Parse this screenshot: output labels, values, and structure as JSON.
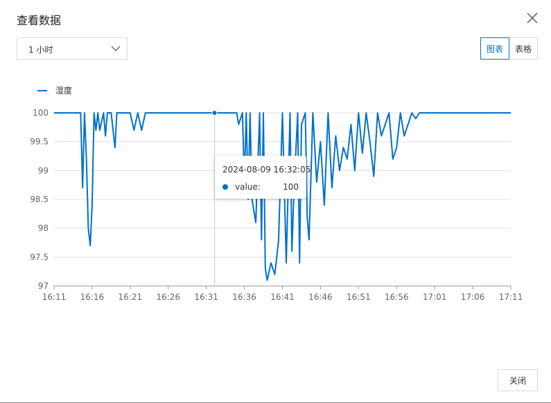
{
  "dialog": {
    "title": "查看数据",
    "close_icon": "close-icon"
  },
  "time_range": {
    "selected": "1 小时",
    "chevron_icon": "chevron-down-icon"
  },
  "view_toggle": {
    "chart_label": "图表",
    "table_label": "表格",
    "active": "chart"
  },
  "tooltip": {
    "time": "2024-08-09 16:32:05",
    "key": "value:",
    "value": "100"
  },
  "footer": {
    "close_label": "关闭"
  },
  "colors": {
    "accent": "#0070cc",
    "grid": "#e0e0e0"
  },
  "chart_data": {
    "type": "line",
    "legend": "湿度",
    "legend_position": "top-left",
    "grid": true,
    "x_ticks": [
      "16:11",
      "16:16",
      "16:21",
      "16:26",
      "16:31",
      "16:36",
      "16:41",
      "16:46",
      "16:51",
      "16:56",
      "17:01",
      "17:06",
      "17:11"
    ],
    "y_ticks": [
      "97",
      "97.5",
      "98",
      "98.5",
      "99",
      "99.5",
      "100"
    ],
    "ylim": [
      97,
      100
    ],
    "series": [
      {
        "name": "湿度",
        "x": [
          "16:11",
          "16:14:30",
          "16:14:45",
          "16:15",
          "16:15:15",
          "16:15:30",
          "16:15:45",
          "16:16",
          "16:16:15",
          "16:16:30",
          "16:16:45",
          "16:17",
          "16:17:30",
          "16:17:45",
          "16:18",
          "16:18:30",
          "16:19",
          "16:19:15",
          "16:19:30",
          "16:20",
          "16:21",
          "16:21:30",
          "16:22",
          "16:22:30",
          "16:23",
          "16:23:15",
          "16:31",
          "16:32:05",
          "16:35",
          "16:35:15",
          "16:35:45",
          "16:36",
          "16:36:15",
          "16:36:30",
          "16:36:45",
          "16:37",
          "16:37:30",
          "16:38",
          "16:38:15",
          "16:38:30",
          "16:38:45",
          "16:39",
          "16:39:30",
          "16:40",
          "16:40:15",
          "16:40:30",
          "16:41",
          "16:41:30",
          "16:42",
          "16:42:15",
          "16:42:30",
          "16:43",
          "16:43:15",
          "16:43:30",
          "16:44",
          "16:44:15",
          "16:44:30",
          "16:45",
          "16:45:30",
          "16:46",
          "16:46:30",
          "16:47",
          "16:47:30",
          "16:48",
          "16:48:30",
          "16:49",
          "16:49:30",
          "16:50",
          "16:50:30",
          "16:51",
          "16:51:30",
          "16:52",
          "16:52:30",
          "16:53",
          "16:53:30",
          "16:54",
          "16:54:30",
          "16:55",
          "16:55:30",
          "16:56",
          "16:56:30",
          "16:57",
          "16:57:30",
          "16:58",
          "16:58:30",
          "16:59",
          "17:11"
        ],
        "values": [
          100,
          100,
          98.7,
          100,
          99.2,
          98.0,
          97.7,
          98.4,
          100,
          99.7,
          100,
          99.7,
          100,
          99.6,
          100,
          100,
          99.4,
          100,
          100,
          100,
          100,
          99.7,
          100,
          99.7,
          100,
          100,
          100,
          100,
          100,
          99.8,
          100,
          98.8,
          100,
          98.5,
          100,
          98.5,
          98.1,
          100,
          97.8,
          100,
          97.3,
          97.1,
          97.4,
          97.2,
          97.5,
          97.8,
          100,
          97.4,
          100,
          97.6,
          98.6,
          100,
          97.4,
          99.8,
          100,
          98.2,
          97.8,
          100,
          98.8,
          99.5,
          98.4,
          100,
          98.7,
          99.6,
          99.0,
          99.4,
          99.2,
          99.8,
          99.0,
          100,
          99.3,
          100,
          99.5,
          98.9,
          100,
          99.6,
          99.8,
          100,
          99.2,
          99.4,
          100,
          99.6,
          99.8,
          100,
          99.9,
          100,
          100
        ]
      }
    ]
  }
}
